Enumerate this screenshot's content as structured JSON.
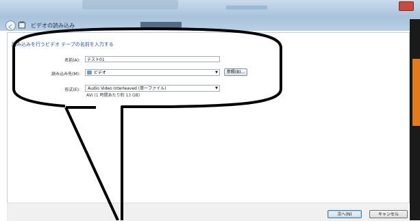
{
  "window": {
    "title": "ビデオの読み込み"
  },
  "page": {
    "heading": "読み込みを行うビデオ テープの名前を入力する",
    "name_label": "名前(A):",
    "name_value": "テスト01",
    "import_to_label": "読み込み先(M):",
    "import_to_value": "ビデオ",
    "browse_button": "参照(B)...",
    "format_label": "形式(E):",
    "format_value": "Audio Video Interleaved (単一ファイル)",
    "format_description": "AVI (1 時間あたり約 13 GB)"
  },
  "footer": {
    "next_button": "次へ(N)",
    "cancel_button": "キャンセル"
  },
  "icons": {
    "back": "back-arrow-icon",
    "title": "video-capture-icon",
    "folder": "video-folder-icon",
    "dropdown": "chevron-down-icon"
  },
  "colors": {
    "heading": "#1e4e9c",
    "callout_outline": "#000000"
  }
}
